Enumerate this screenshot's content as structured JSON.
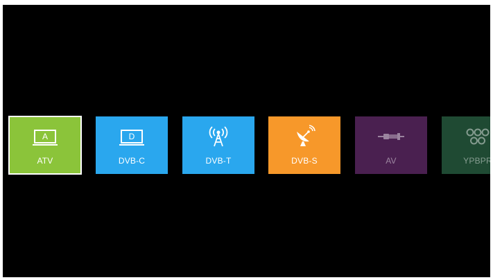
{
  "colors": {
    "background": "#000000",
    "atv": "#8bc43a",
    "dvbc": "#2aa7ee",
    "dvbt": "#2aa7ee",
    "dvbs": "#f7982a",
    "av": "#4a2050",
    "ypbpr": "#1f4a33"
  },
  "sources": [
    {
      "id": "atv",
      "label": "ATV",
      "icon": "analog-tv-icon",
      "glyph": "A",
      "selected": true
    },
    {
      "id": "dvbc",
      "label": "DVB-C",
      "icon": "digital-tv-icon",
      "glyph": "D",
      "selected": false
    },
    {
      "id": "dvbt",
      "label": "DVB-T",
      "icon": "antenna-icon",
      "selected": false
    },
    {
      "id": "dvbs",
      "label": "DVB-S",
      "icon": "satellite-dish-icon",
      "selected": false
    },
    {
      "id": "av",
      "label": "AV",
      "icon": "av-cable-icon",
      "selected": false
    },
    {
      "id": "ypbpr",
      "label": "YPBPR",
      "icon": "component-ports-icon",
      "selected": false
    }
  ]
}
